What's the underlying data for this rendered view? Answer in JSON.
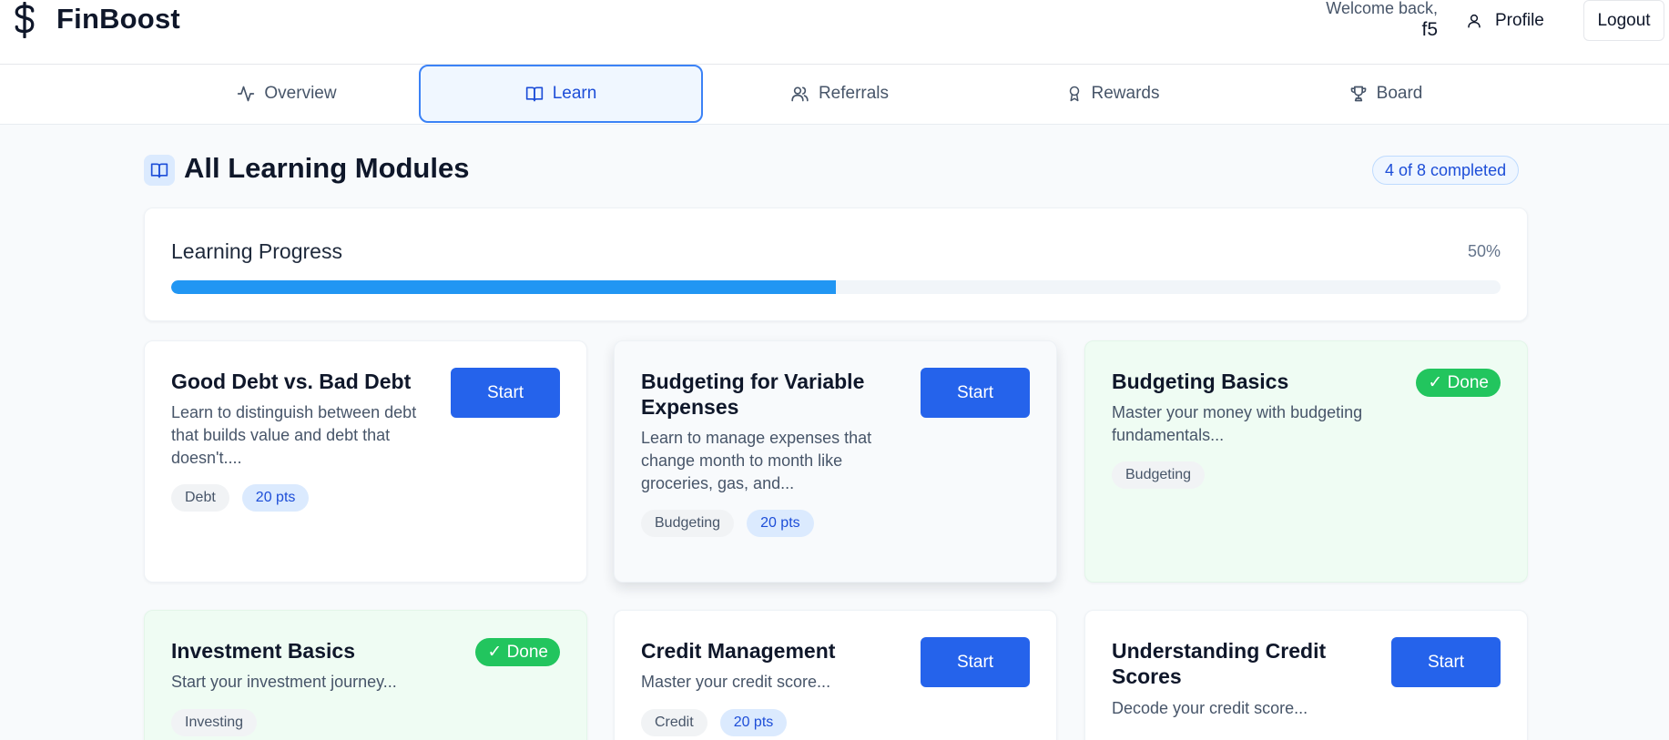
{
  "header": {
    "brand": "FinBoost",
    "welcome": "Welcome back,",
    "user": "f5",
    "profile_label": "Profile",
    "logout_label": "Logout"
  },
  "tabs": [
    {
      "label": "Overview",
      "icon": "activity-icon",
      "active": false
    },
    {
      "label": "Learn",
      "icon": "book-icon",
      "active": true
    },
    {
      "label": "Referrals",
      "icon": "users-icon",
      "active": false
    },
    {
      "label": "Rewards",
      "icon": "award-icon",
      "active": false
    },
    {
      "label": "Board",
      "icon": "trophy-icon",
      "active": false
    }
  ],
  "section": {
    "title": "All Learning Modules",
    "completed": "4 of 8 completed"
  },
  "progress": {
    "label": "Learning Progress",
    "percent_text": "50%",
    "fill_fraction": 0.5
  },
  "modules": [
    {
      "title": "Good Debt vs. Bad Debt",
      "desc": "Learn to distinguish between debt that builds value and debt that doesn't....",
      "category": "Debt",
      "points": "20 pts",
      "action": "Start"
    },
    {
      "title": "Budgeting for Variable Expenses",
      "desc": "Learn to manage expenses that change month to month like groceries, gas, and...",
      "category": "Budgeting",
      "points": "20 pts",
      "action": "Start"
    },
    {
      "title": "Budgeting Basics",
      "desc": "Master your money with budgeting fundamentals...",
      "category": "Budgeting",
      "status": "✓ Done"
    },
    {
      "title": "Investment Basics",
      "desc": "Start your investment journey...",
      "category": "Investing",
      "status": "✓ Done"
    },
    {
      "title": "Credit Management",
      "desc": "Master your credit score...",
      "category": "Credit",
      "points": "20 pts",
      "action": "Start"
    },
    {
      "title": "Understanding Credit Scores",
      "desc": "Decode your credit score...",
      "action": "Start"
    }
  ],
  "colors": {
    "accent": "#2563eb",
    "progress": "#2196f3",
    "done": "#22c55e",
    "done_card_bg": "#effcf3"
  }
}
